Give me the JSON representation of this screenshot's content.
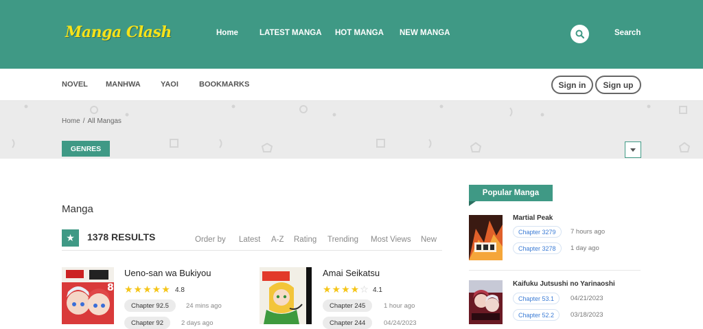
{
  "header": {
    "logo": "Manga Clash",
    "nav": [
      "Home",
      "LATEST MANGA",
      "HOT MANGA",
      "NEW MANGA"
    ],
    "search_label": "Search"
  },
  "subnav": {
    "items": [
      "NOVEL",
      "MANHWA",
      "YAOI",
      "BOOKMARKS"
    ],
    "sign_in": "Sign in",
    "sign_up": "Sign up"
  },
  "breadcrumb": {
    "home": "Home",
    "sep": "/",
    "current": "All Mangas"
  },
  "genres_label": "GENRES",
  "main": {
    "section_title": "Manga",
    "results": "1378 RESULTS",
    "order_by": [
      "Order by",
      "Latest",
      "A-Z",
      "Rating",
      "Trending",
      "Most Views",
      "New"
    ]
  },
  "manga": [
    {
      "title": "Ueno-san wa Bukiyou",
      "rating": "4.8",
      "stars": 5,
      "chapters": [
        {
          "label": "Chapter 92.5",
          "time": "24 mins ago"
        },
        {
          "label": "Chapter 92",
          "time": "2 days ago"
        }
      ]
    },
    {
      "title": "Amai Seikatsu",
      "rating": "4.1",
      "stars": 4,
      "chapters": [
        {
          "label": "Chapter 245",
          "time": "1 hour ago"
        },
        {
          "label": "Chapter 244",
          "time": "04/24/2023"
        }
      ]
    }
  ],
  "popular": {
    "heading": "Popular Manga",
    "items": [
      {
        "title": "Martial Peak",
        "chapters": [
          {
            "label": "Chapter 3279",
            "time": "7 hours ago"
          },
          {
            "label": "Chapter 3278",
            "time": "1 day ago"
          }
        ]
      },
      {
        "title": "Kaifuku Jutsushi no Yarinaoshi",
        "chapters": [
          {
            "label": "Chapter 53.1",
            "time": "04/21/2023"
          },
          {
            "label": "Chapter 52.2",
            "time": "03/18/2023"
          }
        ]
      }
    ]
  },
  "colors": {
    "brand": "#3f9985",
    "logo": "#f5e21a",
    "star": "#f5c518",
    "chapter_link": "#3a7bd5"
  }
}
